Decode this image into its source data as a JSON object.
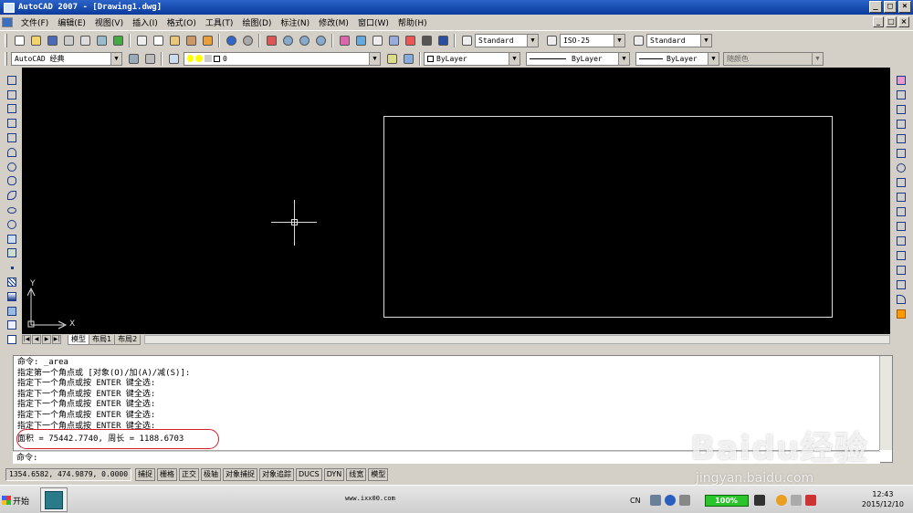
{
  "window": {
    "title": "AutoCAD 2007 - [Drawing1.dwg]",
    "buttons": [
      "_",
      "□",
      "×"
    ]
  },
  "menubar": {
    "items": [
      "文件(F)",
      "编辑(E)",
      "视图(V)",
      "插入(I)",
      "格式(O)",
      "工具(T)",
      "绘图(D)",
      "标注(N)",
      "修改(M)",
      "窗口(W)",
      "帮助(H)"
    ],
    "doc_buttons": [
      "_",
      "□",
      "×"
    ]
  },
  "toolbar1": {
    "text_style": "Standard",
    "dim_style": "ISO-25",
    "table_style": "Standard"
  },
  "toolbar2": {
    "workspace": "AutoCAD 经典",
    "layer": "0",
    "color": "ByLayer",
    "linetype": "ByLayer",
    "lineweight": "ByLayer",
    "plotstyle": "随颜色"
  },
  "canvas": {
    "ucs_x": "X",
    "ucs_y": "Y"
  },
  "layout_tabs": [
    "模型",
    "布局1",
    "布局2"
  ],
  "nav_buttons": [
    "|◀",
    "◀",
    "▶",
    "▶|"
  ],
  "command_history": [
    "命令: _area",
    "指定第一个角点或 [对象(O)/加(A)/减(S)]:",
    "指定下一个角点或按 ENTER 键全选:",
    "指定下一个角点或按 ENTER 键全选:",
    "指定下一个角点或按 ENTER 键全选:",
    "指定下一个角点或按 ENTER 键全选:",
    "指定下一个角点或按 ENTER 键全选:",
    "面积 = 75442.7740, 周长 = 1188.6703"
  ],
  "command_prompt": "命令:",
  "statusbar": {
    "coords": "1354.6582, 474.9879, 0.0000",
    "toggles": [
      "捕捉",
      "栅格",
      "正交",
      "极轴",
      "对象捕捉",
      "对象追踪",
      "DUCS",
      "DYN",
      "线宽",
      "模型"
    ]
  },
  "taskbar": {
    "start_label": "开始",
    "center_text": "www.ixx00.com",
    "lang": "CN",
    "battery": "100%",
    "time": "12:43",
    "date": "2015/12/10"
  },
  "watermark": {
    "logo": "Baidu经验",
    "url": "jingyan.baidu.com"
  },
  "colors": {
    "titlebar": "#0a3b9c",
    "canvas": "#000000",
    "highlight_ellipse": "#d2202a"
  }
}
